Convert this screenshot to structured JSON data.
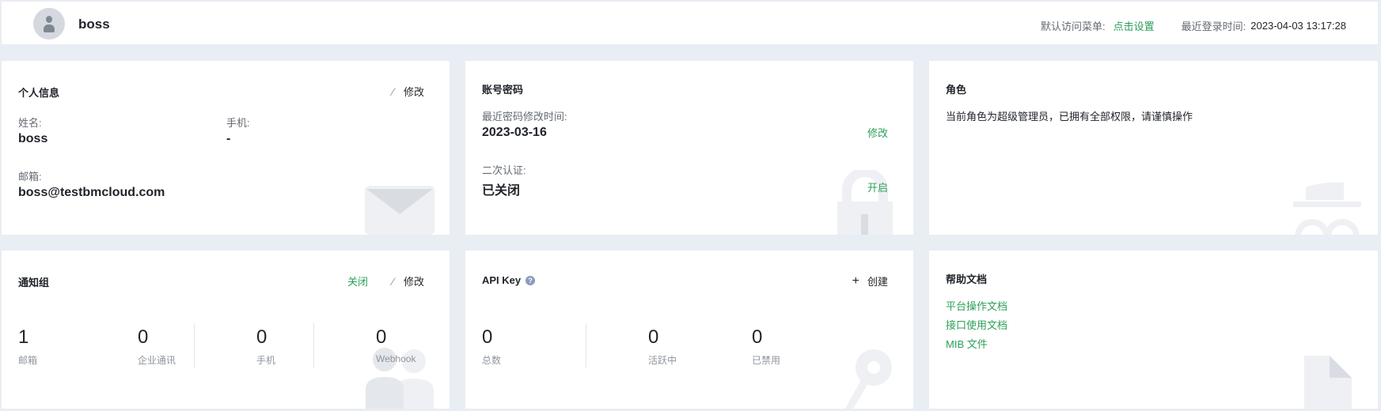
{
  "header": {
    "username": "boss",
    "default_menu_label": "默认访问菜单:",
    "default_menu_link": "点击设置",
    "last_login_label": "最近登录时间:",
    "last_login_value": "2023-04-03 13:17:28"
  },
  "personal_info": {
    "title": "个人信息",
    "edit_label": "修改",
    "name_label": "姓名:",
    "name_value": "boss",
    "phone_label": "手机:",
    "phone_value": "-",
    "email_label": "邮箱:",
    "email_value": "boss@testbmcloud.com"
  },
  "account_password": {
    "title": "账号密码",
    "pwd_changed_label": "最近密码修改时间:",
    "pwd_changed_value": "2023-03-16",
    "pwd_edit_link": "修改",
    "twofa_label": "二次认证:",
    "twofa_value": "已关闭",
    "twofa_enable_link": "开启"
  },
  "role": {
    "title": "角色",
    "description": "当前角色为超级管理员，已拥有全部权限，请谨慎操作"
  },
  "notify_group": {
    "title": "通知组",
    "close_link": "关闭",
    "edit_label": "修改",
    "stats": [
      {
        "num": "1",
        "label": "邮箱"
      },
      {
        "num": "0",
        "label": "企业通讯"
      },
      {
        "num": "0",
        "label": "手机"
      },
      {
        "num": "0",
        "label": "Webhook"
      }
    ]
  },
  "api_key": {
    "title": "API Key",
    "help_icon": "?",
    "create_label": "创建",
    "stats": [
      {
        "num": "0",
        "label": "总数"
      },
      {
        "num": "0",
        "label": "活跃中"
      },
      {
        "num": "0",
        "label": "已禁用"
      }
    ]
  },
  "help_docs": {
    "title": "帮助文档",
    "links": [
      "平台操作文档",
      "接口使用文档",
      "MIB 文件"
    ]
  },
  "colors": {
    "accent_green": "#2ca05a",
    "page_bg": "#e9edf4",
    "decor_gray": "#eef0f3"
  }
}
